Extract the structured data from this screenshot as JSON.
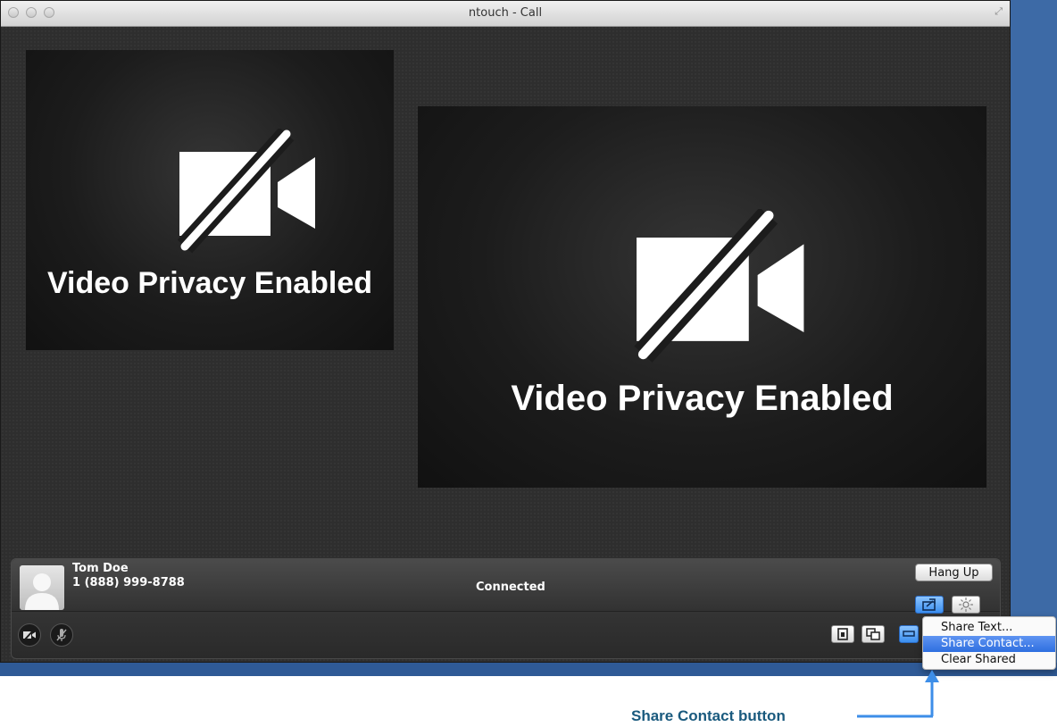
{
  "window": {
    "title": "ntouch - Call"
  },
  "self_view": {
    "privacy_text": "Video Privacy Enabled"
  },
  "remote_view": {
    "privacy_text": "Video Privacy Enabled"
  },
  "call": {
    "contact_name": "Tom Doe",
    "contact_phone": "1 (888) 999-8788",
    "status": "Connected",
    "hang_up_label": "Hang Up"
  },
  "share_menu": {
    "items": [
      {
        "label": "Share Text..."
      },
      {
        "label": "Share Contact..."
      },
      {
        "label": "Clear Shared"
      }
    ],
    "selected_index": 1
  },
  "annotation": {
    "label": "Share Contact button"
  },
  "colors": {
    "accent": "#3b8ef0",
    "annotation": "#1a5a7e",
    "arrow": "#3d8ee8"
  }
}
